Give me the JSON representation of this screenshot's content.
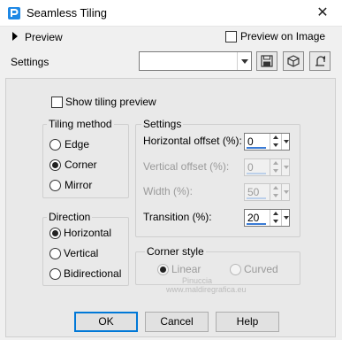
{
  "window": {
    "title": "Seamless Tiling",
    "close_glyph": "✕"
  },
  "preview": {
    "label": "Preview",
    "on_image_label": "Preview on Image",
    "on_image_checked": false
  },
  "settings_bar": {
    "label": "Settings",
    "preset_value": "",
    "icons": [
      "save-preset-icon",
      "3d-cube-icon",
      "reset-icon"
    ]
  },
  "show_tiling_preview": {
    "label": "Show tiling preview",
    "checked": false
  },
  "tiling_method": {
    "title": "Tiling method",
    "options": [
      {
        "label": "Edge",
        "selected": false
      },
      {
        "label": "Corner",
        "selected": true
      },
      {
        "label": "Mirror",
        "selected": false
      }
    ]
  },
  "settings_group": {
    "title": "Settings",
    "horizontal_offset": {
      "label": "Horizontal offset (%):",
      "value": "0",
      "enabled": true
    },
    "vertical_offset": {
      "label": "Vertical offset (%):",
      "value": "0",
      "enabled": false
    },
    "width": {
      "label": "Width (%):",
      "value": "50",
      "enabled": false
    },
    "transition": {
      "label": "Transition (%):",
      "value": "20",
      "enabled": true
    }
  },
  "direction": {
    "title": "Direction",
    "options": [
      {
        "label": "Horizontal",
        "selected": true
      },
      {
        "label": "Vertical",
        "selected": false
      },
      {
        "label": "Bidirectional",
        "selected": false
      }
    ]
  },
  "corner_style": {
    "title": "Corner style",
    "options": [
      {
        "label": "Linear",
        "selected": true,
        "enabled": false
      },
      {
        "label": "Curved",
        "selected": false,
        "enabled": false
      }
    ]
  },
  "watermark": {
    "line1": "Pinuccia",
    "line2": "www.maldiregrafica.eu"
  },
  "buttons": {
    "ok": "OK",
    "cancel": "Cancel",
    "help": "Help"
  },
  "colors": {
    "accent": "#0078d7",
    "spin_bar": "#3a7bd5",
    "panel": "#e9e9e9",
    "window": "#f0f0f0"
  }
}
